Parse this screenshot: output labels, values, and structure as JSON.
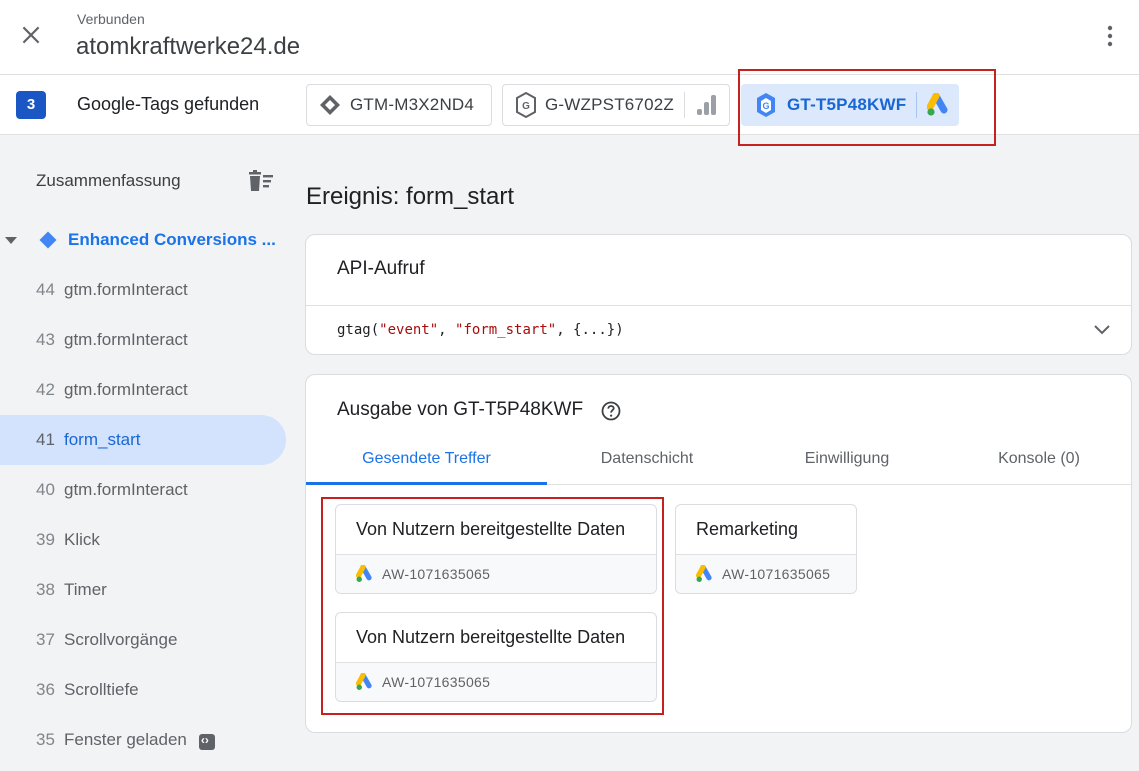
{
  "header": {
    "status": "Verbunden",
    "domain": "atomkraftwerke24.de"
  },
  "tags_bar": {
    "count": "3",
    "label": "Google-Tags gefunden",
    "chips": [
      {
        "id": "GTM-M3X2ND4",
        "icon": "gtm-diamond-icon"
      },
      {
        "id": "G-WZPST6702Z",
        "icon": "google-tag-icon",
        "product_icon": "analytics-bars-icon"
      },
      {
        "id": "GT-T5P48KWF",
        "icon": "google-tag-icon",
        "product_icon": "google-ads-icon",
        "selected": true
      }
    ]
  },
  "sidebar": {
    "summary_label": "Zusammenfassung",
    "group_label": "Enhanced Conversions ...",
    "events": [
      {
        "num": "44",
        "name": "gtm.formInteract"
      },
      {
        "num": "43",
        "name": "gtm.formInteract"
      },
      {
        "num": "42",
        "name": "gtm.formInteract"
      },
      {
        "num": "41",
        "name": "form_start",
        "active": true
      },
      {
        "num": "40",
        "name": "gtm.formInteract"
      },
      {
        "num": "39",
        "name": "Klick"
      },
      {
        "num": "38",
        "name": "Timer"
      },
      {
        "num": "37",
        "name": "Scrollvorgänge"
      },
      {
        "num": "36",
        "name": "Scrolltiefe"
      },
      {
        "num": "35",
        "name": "Fenster geladen"
      }
    ]
  },
  "main": {
    "event_title": "Ereignis: form_start",
    "api_card": {
      "title": "API-Aufruf",
      "call_prefix": "gtag(",
      "call_arg1": "\"event\"",
      "call_sep": ", ",
      "call_arg2": "\"form_start\"",
      "call_suffix": ", {...})"
    },
    "output_card": {
      "title": "Ausgabe von GT-T5P48KWF",
      "tabs": [
        "Gesendete Treffer",
        "Datenschicht",
        "Einwilligung",
        "Konsole (0)"
      ],
      "hits": [
        {
          "title": "Von Nutzern bereitgestellte Daten",
          "account": "AW-1071635065"
        },
        {
          "title": "Remarketing",
          "account": "AW-1071635065"
        },
        {
          "title": "Von Nutzern bereitgestellte Daten",
          "account": "AW-1071635065"
        }
      ]
    }
  },
  "colors": {
    "accent": "#1a73e8",
    "highlight": "#c5221f",
    "count_badge": "#1a57c4"
  }
}
